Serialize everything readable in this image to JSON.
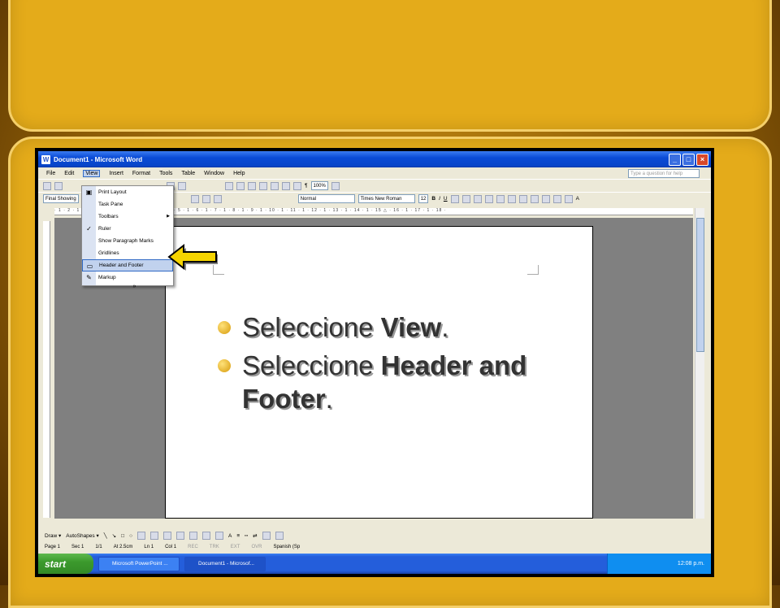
{
  "slide": {
    "bullets": [
      {
        "prefix": "Seleccione ",
        "bold": "View",
        "suffix": "."
      },
      {
        "prefix": "Seleccione ",
        "bold": "Header and Footer",
        "suffix": "."
      }
    ]
  },
  "window": {
    "title": "Document1 - Microsoft Word",
    "controls": {
      "minimize": "_",
      "maximize": "□",
      "close": "×"
    }
  },
  "menubar": {
    "items": [
      "File",
      "Edit",
      "View",
      "Insert",
      "Format",
      "Tools",
      "Table",
      "Window",
      "Help"
    ],
    "active": "View",
    "ask_placeholder": "Type a question for help"
  },
  "toolbar": {
    "zoom": "100%",
    "final_showing": "Final Showing",
    "style": "Normal",
    "font": "Times New Roman",
    "font_size": "12"
  },
  "view_menu": {
    "items": [
      {
        "label": "Print Layout",
        "icon": "print-layout-icon",
        "highlighted": false
      },
      {
        "label": "Task Pane",
        "icon": "",
        "highlighted": false
      },
      {
        "label": "Toolbars",
        "icon": "",
        "submenu": true,
        "highlighted": false
      },
      {
        "label": "Ruler",
        "icon": "check-icon",
        "highlighted": false
      },
      {
        "label": "Show Paragraph Marks",
        "icon": "",
        "highlighted": false
      },
      {
        "label": "Gridlines",
        "icon": "",
        "highlighted": false
      },
      {
        "label": "Header and Footer",
        "icon": "header-footer-icon",
        "highlighted": true
      },
      {
        "label": "Markup",
        "icon": "markup-icon",
        "highlighted": false
      }
    ],
    "more": "»"
  },
  "drawbar": {
    "draw": "Draw ▾",
    "autoshapes": "AutoShapes ▾"
  },
  "statusbar": {
    "page": "Page 1",
    "sec": "Sec 1",
    "pages": "1/1",
    "at": "At 2.5cm",
    "ln": "Ln 1",
    "col": "Col 1",
    "rec": "REC",
    "trk": "TRK",
    "ext": "EXT",
    "ovr": "OVR",
    "lang": "Spanish (Sp"
  },
  "taskbar": {
    "start": "start",
    "tasks": [
      "Microsoft PowerPoint ...",
      "Document1 - Microsof..."
    ],
    "clock": "12:08 p.m."
  },
  "colors": {
    "slide_bg": "#e4ab1a",
    "arrow": "#f5d400",
    "title_bar": "#0a4bd6",
    "menu_highlight": "#c1d2ee"
  }
}
